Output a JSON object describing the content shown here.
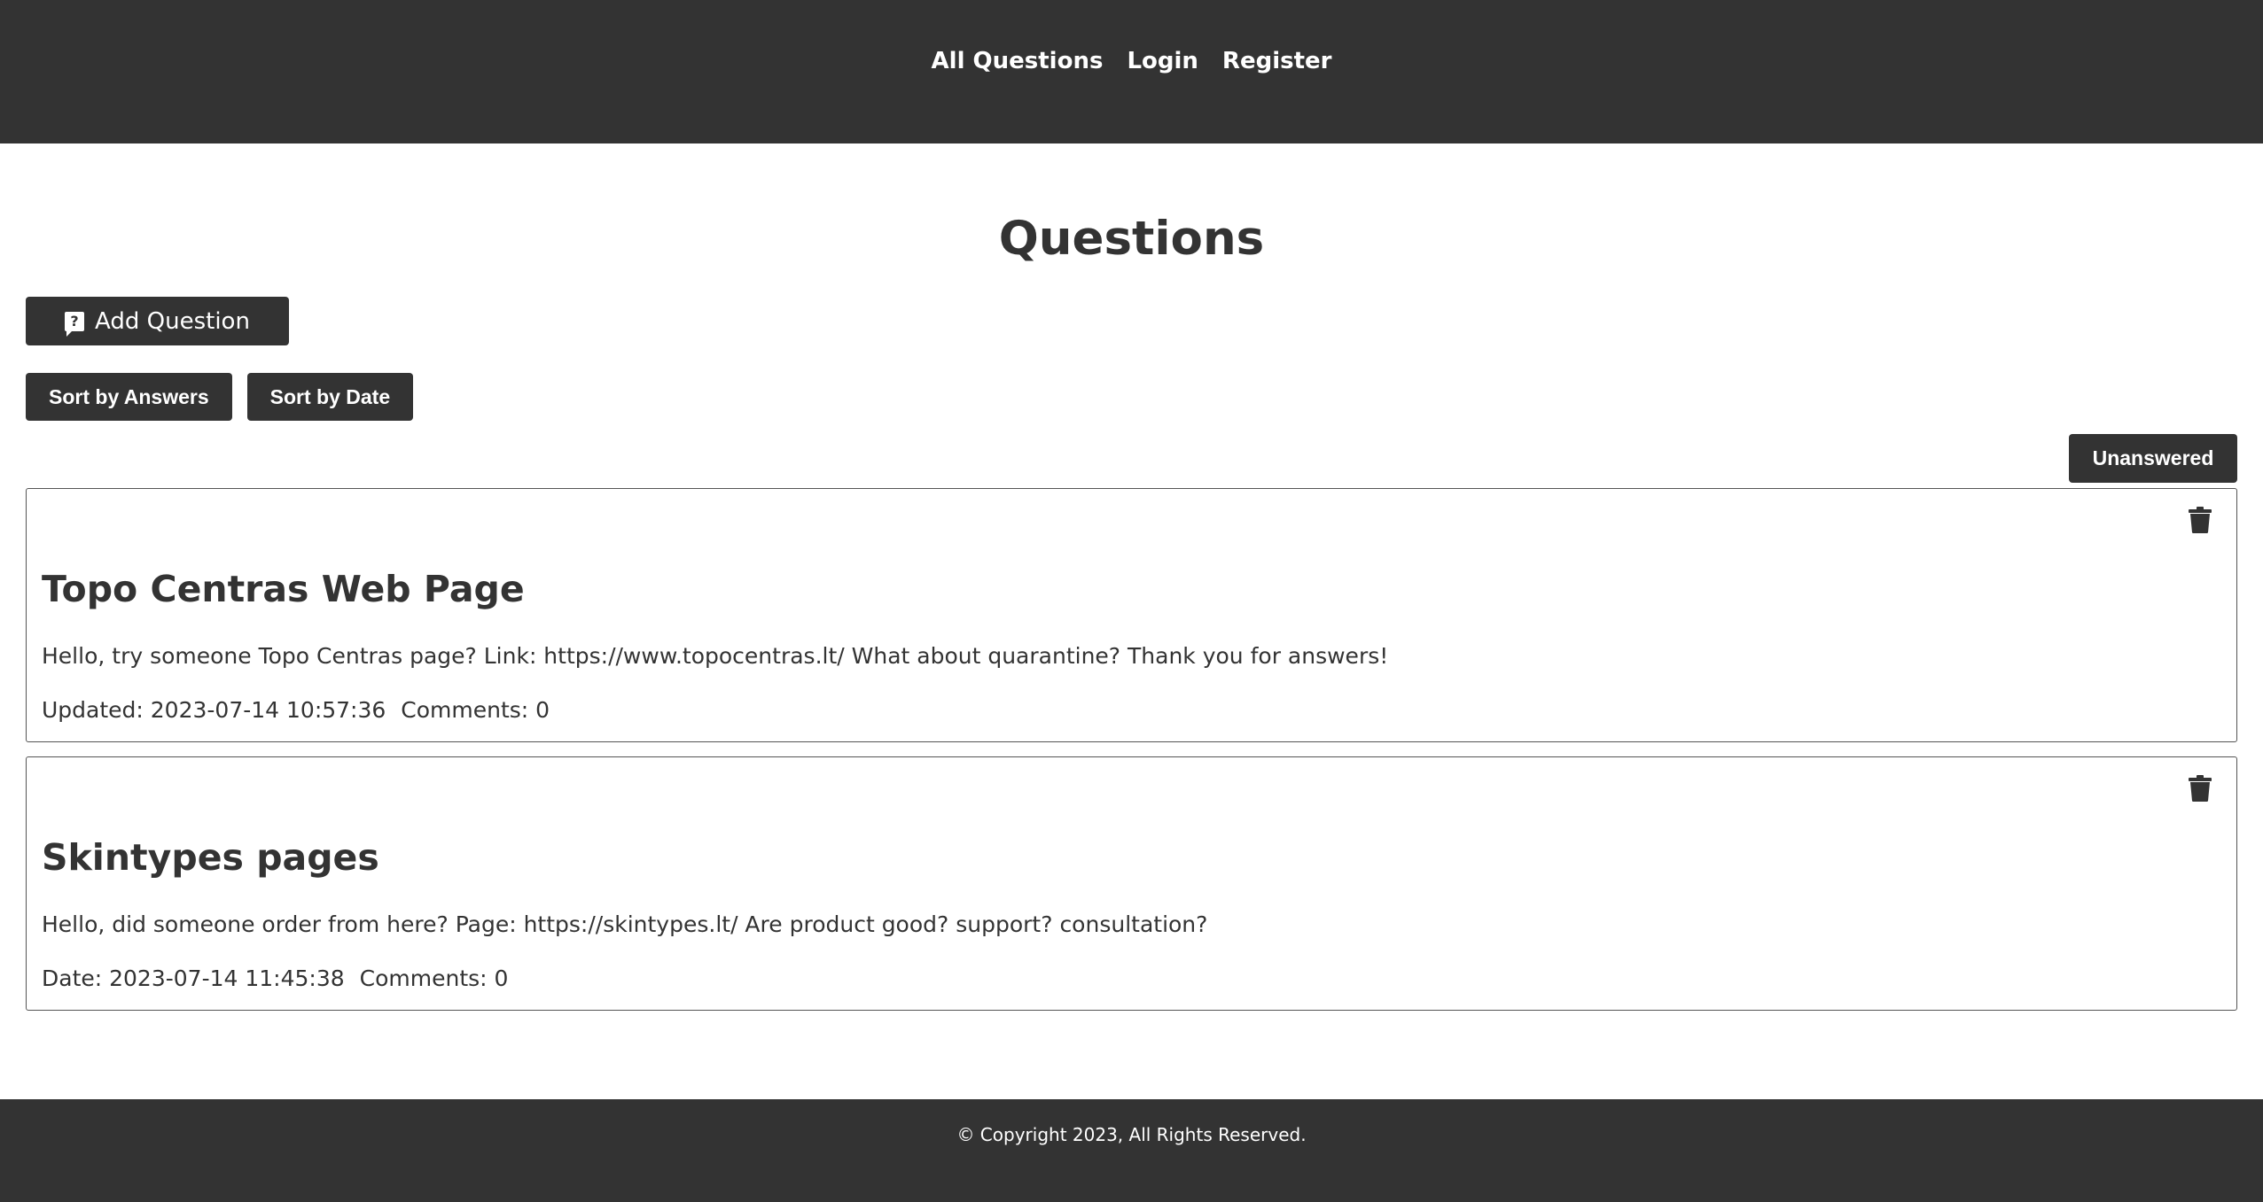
{
  "nav": {
    "all_questions": "All Questions",
    "login": "Login",
    "register": "Register"
  },
  "main": {
    "title": "Questions",
    "add_question_label": "Add Question",
    "add_question_icon": "question-bubble-icon",
    "sort_answers_label": "Sort by Answers",
    "sort_date_label": "Sort by Date",
    "unanswered_label": "Unanswered"
  },
  "questions": [
    {
      "title": "Topo Centras Web Page",
      "body": "Hello, try someone Topo Centras page? Link: https://www.topocentras.lt/ What about quarantine? Thank you for answers!",
      "date_label": "Updated: 2023-07-14 10:57:36",
      "comments_label": "Comments: 0",
      "icon": "trash-icon"
    },
    {
      "title": "Skintypes pages",
      "body": "Hello, did someone order from here? Page: https://skintypes.lt/ Are product good? support? consultation?",
      "date_label": "Date: 2023-07-14 11:45:38",
      "comments_label": "Comments: 0",
      "icon": "trash-icon"
    }
  ],
  "footer": {
    "copyright": "© Copyright 2023, All Rights Reserved."
  },
  "colors": {
    "header_bg": "#333333",
    "button_bg": "#333333",
    "text": "#333333",
    "background": "#ffffff"
  }
}
